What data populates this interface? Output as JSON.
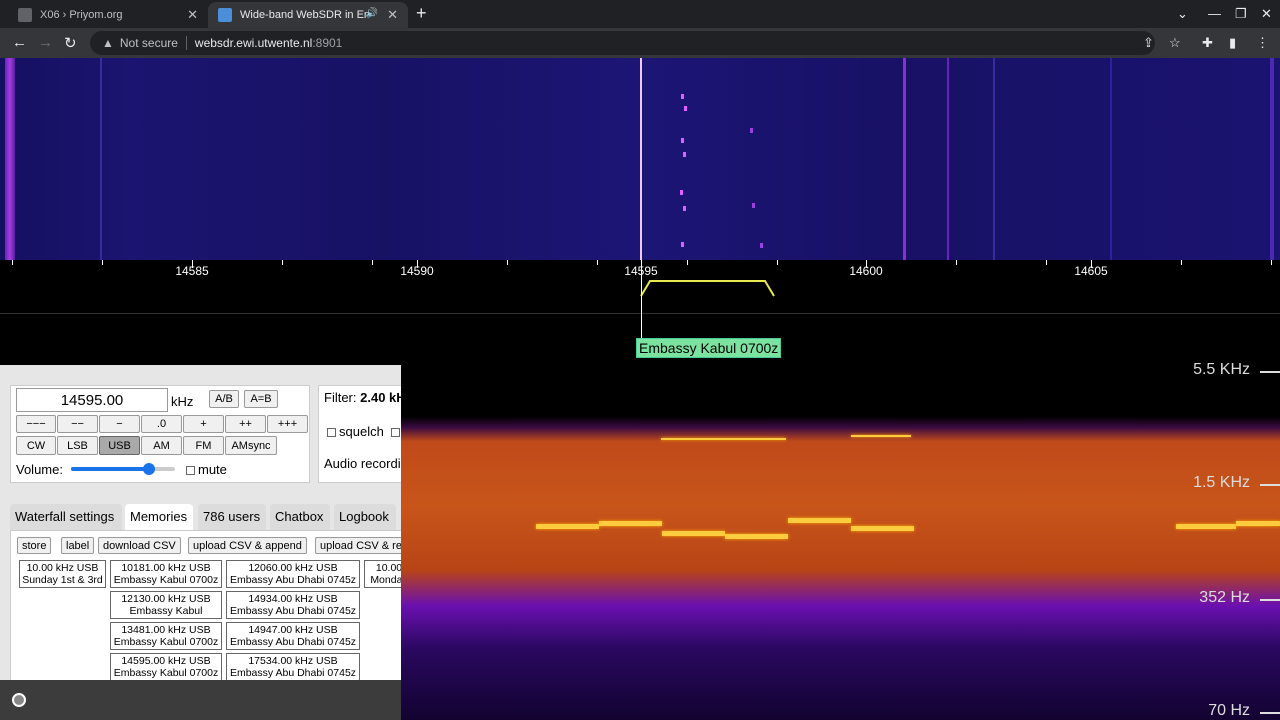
{
  "browser": {
    "tabs": [
      {
        "title": "X06 › Priyom.org",
        "active": false
      },
      {
        "title": "Wide-band WebSDR in Ensc",
        "active": true
      }
    ],
    "url_host": "websdr.ewi.utwente.nl",
    "url_port": ":8901",
    "not_secure": "Not secure"
  },
  "scale": {
    "labels": [
      "14585",
      "14590",
      "14595",
      "14600",
      "14605"
    ]
  },
  "tuned_memory_label": "Embassy Kabul 0700z",
  "spectrogram": {
    "hz_labels": [
      "5.5  KHz",
      "1.5  KHz",
      "352  Hz",
      "70  Hz"
    ]
  },
  "controls": {
    "frequency": "14595.00",
    "unit": "kHz",
    "ab_buttons": [
      "A/B",
      "A=B"
    ],
    "step_buttons": [
      "−−−",
      "−−",
      "−",
      ".0",
      "+",
      "++",
      "+++"
    ],
    "modes": [
      "CW",
      "LSB",
      "USB",
      "AM",
      "FM",
      "AMsync"
    ],
    "active_mode": "USB",
    "volume_label": "Volume:",
    "volume_level": 0.75,
    "mute_label": "mute",
    "filter_label": "Filter:",
    "filter_value": "2.40 kH",
    "squelch_label": "squelch",
    "audio_recording_label": "Audio recordi"
  },
  "panel_tabs": [
    "Waterfall settings",
    "Memories",
    "786 users",
    "Chatbox",
    "Logbook"
  ],
  "active_panel_tab": "Memories",
  "memory_buttons": [
    "store",
    "label",
    "download CSV",
    "upload CSV & append",
    "upload CSV & re"
  ],
  "memories": [
    {
      "line1": "10.00 kHz USB",
      "line2": "Sunday 1st & 3rd"
    },
    {
      "line1": "10181.00 kHz USB",
      "line2": "Embassy Kabul 0700z"
    },
    {
      "line1": "12060.00 kHz USB",
      "line2": "Embassy Abu Dhabi 0745z"
    },
    {
      "line1": "10.00",
      "line2": "Monday"
    },
    {
      "line1": "12130.00 kHz USB",
      "line2": "Embassy Kabul"
    },
    {
      "line1": "14934.00 kHz USB",
      "line2": "Embassy Abu Dhabi 0745z"
    },
    {
      "line1": "13481.00 kHz USB",
      "line2": "Embassy Kabul 0700z"
    },
    {
      "line1": "14947.00 kHz USB",
      "line2": "Embassy Abu Dhabi 0745z"
    },
    {
      "line1": "14595.00 kHz USB",
      "line2": "Embassy Kabul 0700z"
    },
    {
      "line1": "17534.00 kHz USB",
      "line2": "Embassy Abu Dhabi 0745z"
    }
  ],
  "colors": {
    "waterfall_bg": "#181265",
    "signal_trace": "#ffcc40",
    "memory_label_bg": "#7ce2a0",
    "passband": "#e8e850"
  }
}
